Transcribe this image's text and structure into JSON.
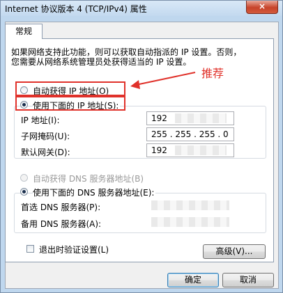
{
  "window": {
    "title": "Internet 协议版本 4 (TCP/IPv4) 属性",
    "close_glyph": "×",
    "title_color": "#000000"
  },
  "tabs": [
    "常规"
  ],
  "description": {
    "line1": "如果网络支持此功能，则可以获取自动指派的 IP 设置。否则，",
    "line2": "您需要从网络系统管理员处获得适当的 IP 设置。"
  },
  "ip_section": {
    "auto_label": "自动获得 IP 地址(O)",
    "manual_label": "使用下面的 IP 地址(S):",
    "selected": "manual",
    "fields": [
      {
        "label": "IP 地址(I):",
        "value": "192"
      },
      {
        "label": "子网掩码(U):",
        "value": "255 . 255 . 255 . 0"
      },
      {
        "label": "默认网关(D):",
        "value": "192"
      }
    ]
  },
  "dns_section": {
    "auto_label": "自动获得 DNS 服务器地址(B)",
    "manual_label": "使用下面的 DNS 服务器地址(E):",
    "selected": "manual",
    "fields": [
      {
        "label": "首选 DNS 服务器(P):",
        "value": ""
      },
      {
        "label": "备用 DNS 服务器(A):",
        "value": ""
      }
    ]
  },
  "validate_checkbox": {
    "label": "退出时验证设置(L)",
    "checked": false
  },
  "buttons": {
    "advanced": "高级(V)...",
    "ok": "确定",
    "cancel": "取消"
  },
  "annotation": {
    "text": "推荐",
    "color": "#e0312a"
  }
}
